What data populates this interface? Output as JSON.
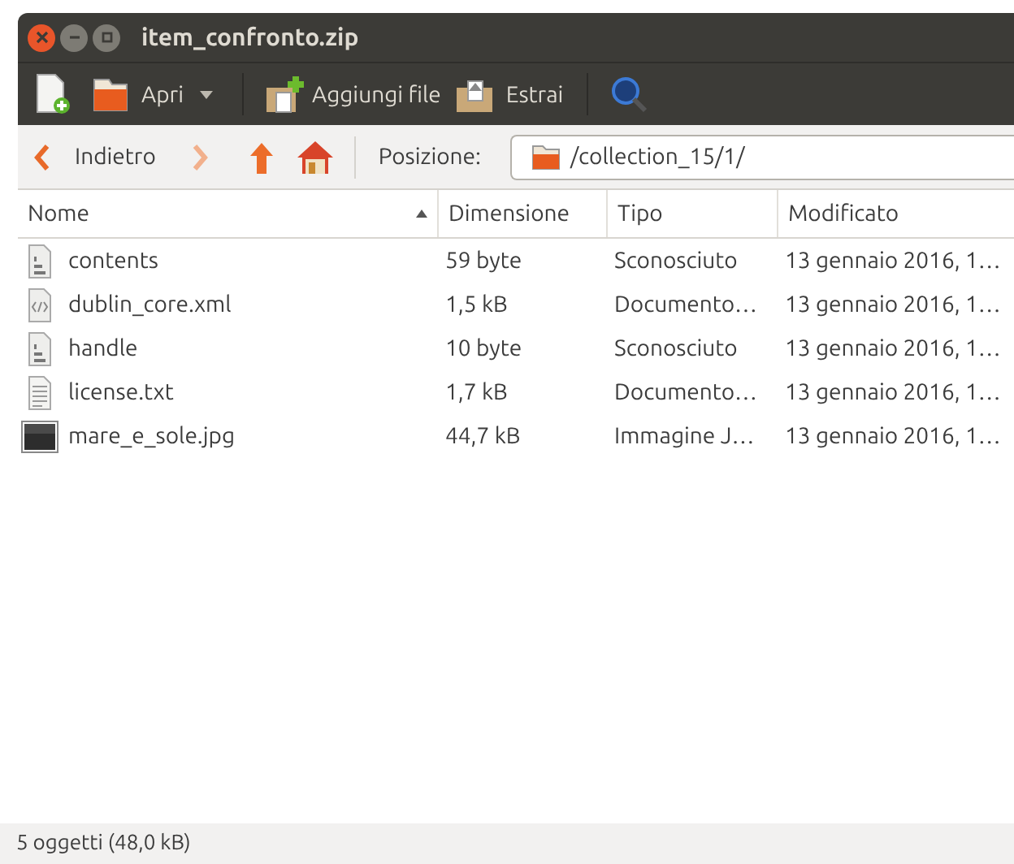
{
  "window": {
    "title": "item_confronto.zip"
  },
  "toolbar": {
    "open_label": "Apri",
    "add_label": "Aggiungi file",
    "extract_label": "Estrai"
  },
  "location_bar": {
    "back_label": "Indietro",
    "location_label": "Posizione:",
    "path": "/collection_15/1/"
  },
  "table": {
    "columns": [
      {
        "label": "Nome",
        "sorted": true
      },
      {
        "label": "Dimensione",
        "sorted": false
      },
      {
        "label": "Tipo",
        "sorted": false
      },
      {
        "label": "Modificato",
        "sorted": false
      }
    ],
    "rows": [
      {
        "kind": "binary",
        "name": "contents",
        "size": "59 byte",
        "type": "Sconosciuto",
        "modified": "13 gennaio 2016, 1…"
      },
      {
        "kind": "xml",
        "name": "dublin_core.xml",
        "size": "1,5 kB",
        "type": "Documento…",
        "modified": "13 gennaio 2016, 1…"
      },
      {
        "kind": "binary",
        "name": "handle",
        "size": "10 byte",
        "type": "Sconosciuto",
        "modified": "13 gennaio 2016, 1…"
      },
      {
        "kind": "text",
        "name": "license.txt",
        "size": "1,7 kB",
        "type": "Documento…",
        "modified": "13 gennaio 2016, 1…"
      },
      {
        "kind": "image",
        "name": "mare_e_sole.jpg",
        "size": "44,7 kB",
        "type": "Immagine J…",
        "modified": "13 gennaio 2016, 1…"
      }
    ]
  },
  "status_bar": "5 oggetti (48,0 kB)"
}
